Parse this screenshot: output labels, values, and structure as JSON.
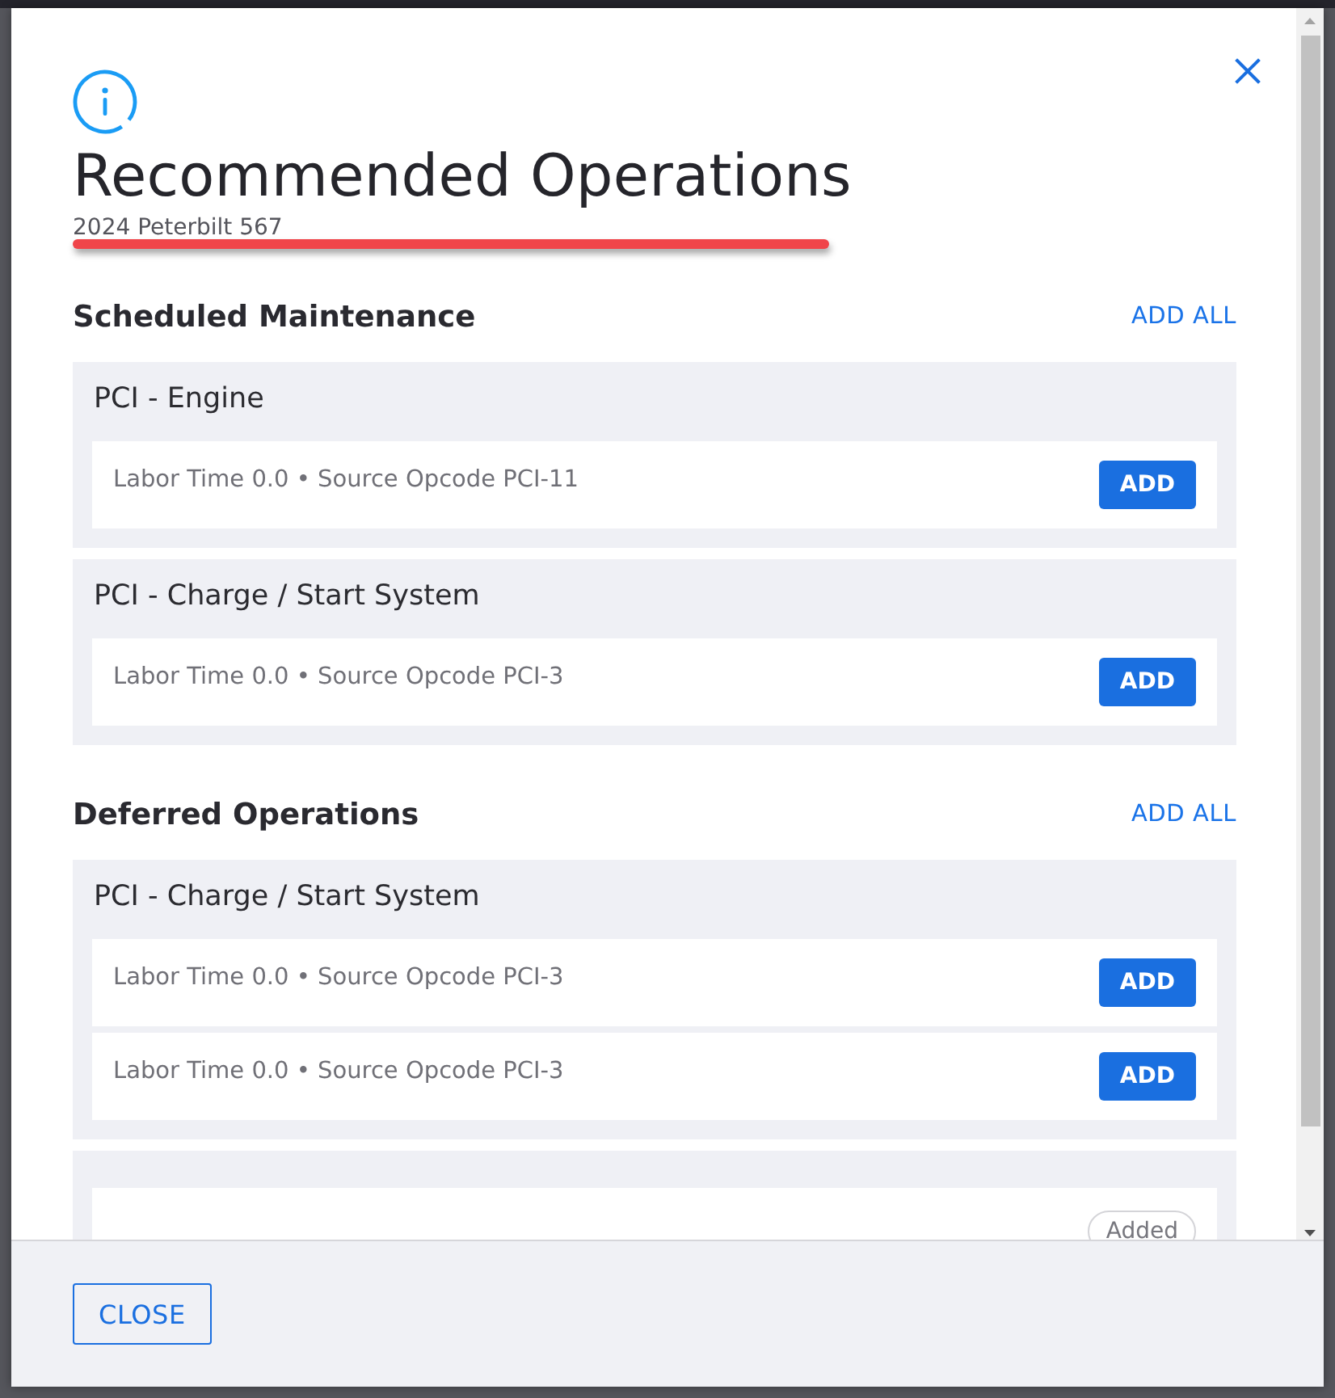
{
  "dialog": {
    "title": "Recommended Operations",
    "subtitle": "2024 Peterbilt 567"
  },
  "sections": [
    {
      "heading": "Scheduled Maintenance",
      "action": "ADD ALL",
      "groups": [
        {
          "title": "PCI - Engine",
          "operations": [
            {
              "detail": "Labor Time 0.0 • Source Opcode PCI-11",
              "added": false,
              "action": "ADD"
            }
          ]
        },
        {
          "title": "PCI - Charge / Start System",
          "operations": [
            {
              "detail": "Labor Time 0.0 • Source Opcode PCI-3",
              "added": false,
              "action": "ADD"
            }
          ]
        }
      ]
    },
    {
      "heading": "Deferred Operations",
      "action": "ADD ALL",
      "groups": [
        {
          "title": "PCI - Charge / Start System",
          "operations": [
            {
              "detail": "Labor Time 0.0 • Source Opcode PCI-3",
              "added": false,
              "action": "ADD"
            },
            {
              "detail": "Labor Time 0.0 • Source Opcode PCI-3",
              "added": false,
              "action": "ADD"
            }
          ]
        },
        {
          "operations": [
            {
              "added": true,
              "action": "Added"
            }
          ]
        }
      ]
    }
  ],
  "footer": {
    "close_button": "CLOSE"
  }
}
